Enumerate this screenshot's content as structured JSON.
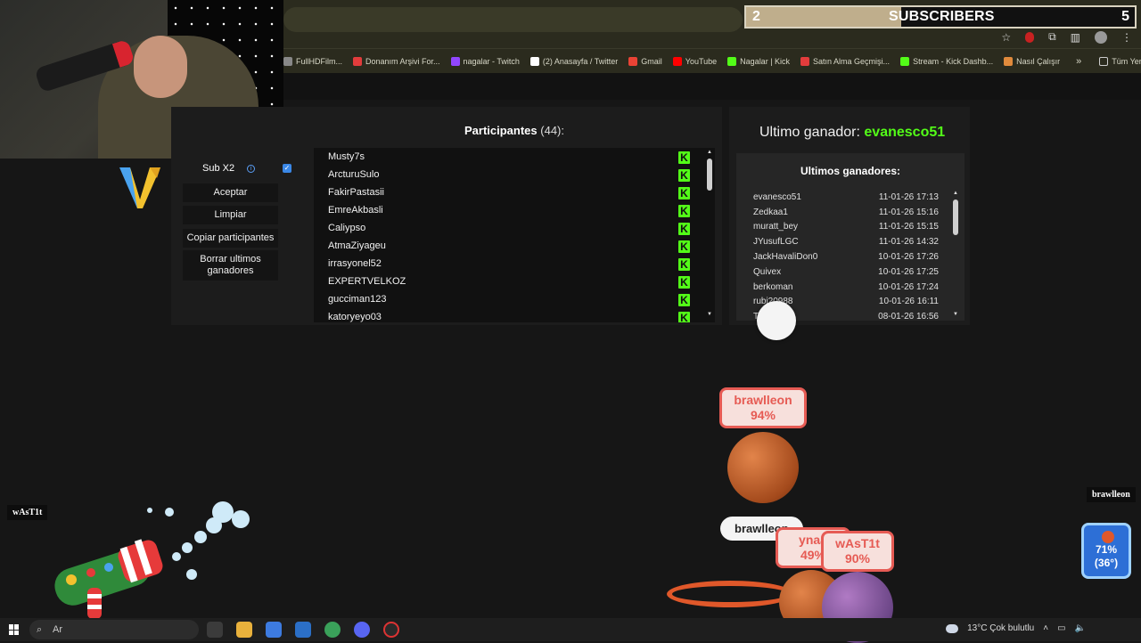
{
  "subscriber_bar": {
    "current": "2",
    "label": "SUBSCRIBERS",
    "goal": "5",
    "progress_fraction": 0.4
  },
  "bookmarks": [
    {
      "label": "FullHDFilm...",
      "icon": "film-icon",
      "color": "#888888"
    },
    {
      "label": "Donanım Arşivi For...",
      "icon": "forum-icon",
      "color": "#e23c3c"
    },
    {
      "label": "nagalar - Twitch",
      "icon": "twitch-icon",
      "color": "#9146ff"
    },
    {
      "label": "(2) Anasayfa / Twitter",
      "icon": "x-icon",
      "color": "#ffffff"
    },
    {
      "label": "Gmail",
      "icon": "gmail-icon",
      "color": "#ea4335"
    },
    {
      "label": "YouTube",
      "icon": "youtube-icon",
      "color": "#ff0000"
    },
    {
      "label": "Nagalar | Kick",
      "icon": "kick-icon",
      "color": "#53fc18"
    },
    {
      "label": "Satın Alma Geçmişi...",
      "icon": "circle-icon",
      "color": "#e23c3c"
    },
    {
      "label": "Stream - Kick Dashb...",
      "icon": "kick-icon",
      "color": "#53fc18"
    },
    {
      "label": "Nasıl Çalışır",
      "icon": "fox-icon",
      "color": "#e08a3c"
    }
  ],
  "bookmarks_more": "»",
  "bookmarks_folder": "Tüm Yer İşaretleri",
  "controls": {
    "sub_x2_label": "Sub X2",
    "sub_x2_checked": true,
    "buttons": [
      "Aceptar",
      "Limpiar",
      "Copiar participantes",
      "Borrar ultimos ganadores"
    ]
  },
  "participants": {
    "title": "Participantes",
    "count": "(44):",
    "items": [
      "Musty7s",
      "ArcturuSulo",
      "FakirPastasii",
      "EmreAkbasli",
      "Caliypso",
      "AtmaZiyageu",
      "irrasyonel52",
      "EXPERTVELKOZ",
      "gucciman123",
      "katoryeyo03"
    ],
    "platform_icon": "kick-icon",
    "platform_color": "#53fc18"
  },
  "last_winner": {
    "label": "Ultimo ganador:",
    "name": "evanesco51",
    "name_color": "#53fc18"
  },
  "recent_winners": {
    "title": "Ultimos ganadores:",
    "rows": [
      {
        "name": "evanesco51",
        "date": "11-01-26 17:13"
      },
      {
        "name": "Zedkaa1",
        "date": "11-01-26 15:16"
      },
      {
        "name": "muratt_bey",
        "date": "11-01-26 15:15"
      },
      {
        "name": "JYusufLGC",
        "date": "11-01-26 14:32"
      },
      {
        "name": "JackHavaliDon0",
        "date": "10-01-26 17:26"
      },
      {
        "name": "Quivex",
        "date": "10-01-26 17:25"
      },
      {
        "name": "berkoman",
        "date": "10-01-26 17:24"
      },
      {
        "name": "rubi20988",
        "date": "10-01-26 16:11"
      },
      {
        "name": "The",
        "date": "08-01-26 16:56"
      }
    ]
  },
  "overlay": {
    "brawlleon_card": {
      "name": "brawlleon",
      "pct": "94%"
    },
    "brawlleon_tag": "brawlleon",
    "card_partial": {
      "name": "ynaa",
      "pct": "49%"
    },
    "wast1t_card": {
      "name": "wAsT1t",
      "pct": "90%"
    },
    "left_label": "wAsT1t",
    "right_label": "brawlleon",
    "stats_badge": {
      "pct": "71%",
      "angle": "(36°)"
    }
  },
  "taskbar": {
    "search_text": "Ar",
    "weather": "13°C  Çok bulutlu"
  }
}
